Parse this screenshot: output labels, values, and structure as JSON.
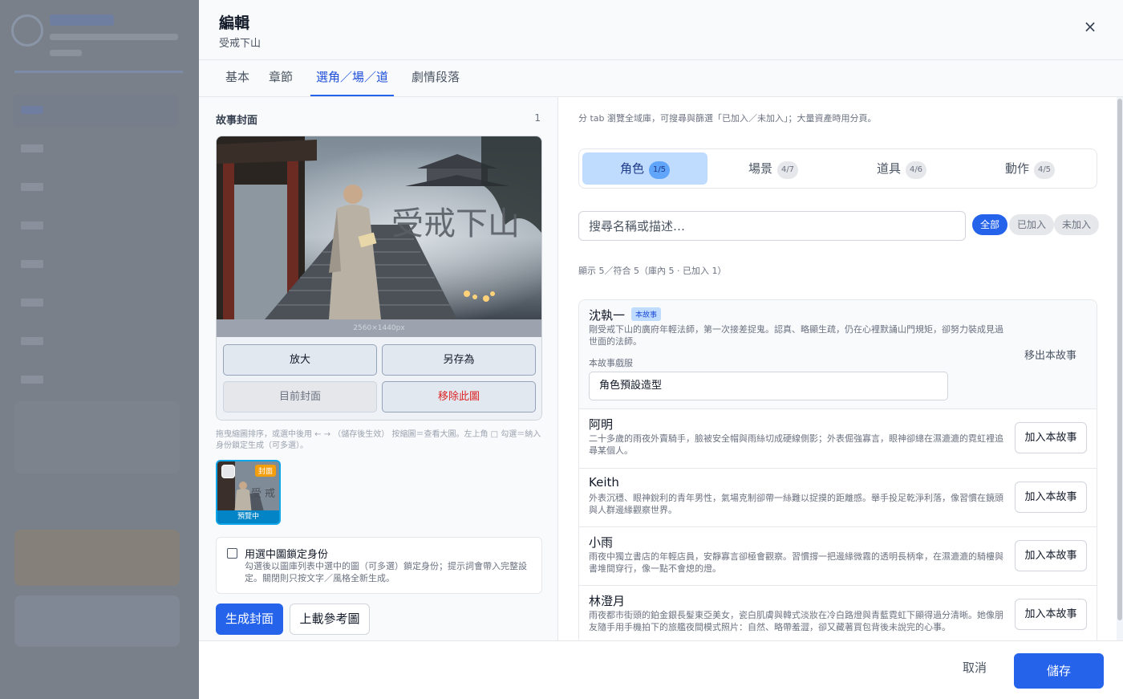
{
  "drawer": {
    "title": "編輯",
    "subtitle": "受戒下山",
    "close_glyph": "×"
  },
  "tabs": [
    {
      "label": "基本",
      "active": false
    },
    {
      "label": "章節",
      "active": false
    },
    {
      "label": "選角／場／道具",
      "active": true
    },
    {
      "label": "劇情段落",
      "active": false
    }
  ],
  "cover": {
    "section_title": "故事封面",
    "count": "1",
    "image_title": "受戒下山",
    "dimensions": "2560×1440px",
    "buttons": {
      "zoom": "放大",
      "save_as": "另存為",
      "current_cover": "目前封面",
      "remove": "移除此圖"
    },
    "hint": "拖曳縮圖排序，或選中後用 ← → （儲存後生效） 按縮圖＝查看大圖。左上角 □ 勾選＝納入身份鎖定生成（可多選）。",
    "thumbnail": {
      "badge": "封面",
      "status": "預覽中",
      "image_text": "受 戒"
    },
    "lock": {
      "label": "用選中圖鎖定身份",
      "description": "勾選後以圖庫列表中選中的圖（可多選）鎖定身份；提示詞會帶入完整設定。關閉則只按文字／風格全新生成。",
      "checked": false
    },
    "generate_label": "生成封面",
    "upload_label": "上載參考圖"
  },
  "assets": {
    "intro": "分 tab 瀏覽全域庫，可搜尋與篩選「已加入／未加入」；大量資產時用分頁。",
    "tabs": [
      {
        "label": "角色",
        "count": "1/5",
        "active": true
      },
      {
        "label": "場景",
        "count": "4/7",
        "active": false
      },
      {
        "label": "道具",
        "count": "4/6",
        "active": false
      },
      {
        "label": "動作",
        "count": "4/5",
        "active": false
      }
    ],
    "search_placeholder": "搜尋名稱或描述…",
    "filters": [
      {
        "label": "全部",
        "active": true
      },
      {
        "label": "已加入",
        "active": false
      },
      {
        "label": "未加入",
        "active": false
      }
    ],
    "summary": "顯示 5／符合 5（庫內 5 · 已加入 1）",
    "items": [
      {
        "name": "沈執一",
        "badge": "本故事",
        "description": "剛受戒下山的廣府年輕法師，第一次接差捉鬼。認真、略顯生疏，仍在心裡默誦山門規矩，卻努力裝成見過世面的法師。",
        "action": "移出本故事",
        "costume_label": "本故事戲服",
        "costume_value": "角色預設造型"
      },
      {
        "name": "阿明",
        "description": "二十多歲的雨夜外賣騎手，臉被安全帽與雨絲切成硬線側影；外表倔強寡言，眼神卻總在濕漉漉的霓虹裡追尋某個人。",
        "action": "加入本故事"
      },
      {
        "name": "Keith",
        "description": "外表沉穩、眼神銳利的青年男性，氣場克制卻帶一絲難以捉摸的距離感。舉手投足乾淨利落，像習慣在鏡頭與人群邊緣觀察世界。",
        "action": "加入本故事"
      },
      {
        "name": "小雨",
        "description": "雨夜中獨立書店的年輕店員，安靜寡言卻極會觀察。習慣撐一把邊緣微霧的透明長柄傘，在濕漉漉的騎樓與書堆間穿行，像一點不會熄的燈。",
        "action": "加入本故事"
      },
      {
        "name": "林澄月",
        "description": "雨夜都市街頭的鉑金銀長髮東亞美女，瓷白肌膚與韓式淡妝在冷白路燈與青藍霓虹下顯得過分清晰。她像朋友隨手用手機拍下的旅艦夜間模式照片：自然、略帶羞澀，卻又藏著買包背後未說完的心事。",
        "action": "加入本故事"
      }
    ]
  },
  "footer": {
    "cancel_label": "取消",
    "save_label": "儲存"
  },
  "colors": {
    "accent": "#2563eb",
    "accent_light": "#bfdbfe",
    "danger": "#dc2626",
    "thumb_border": "#0ea5e9",
    "badge_orange": "#f59e0b"
  },
  "icons": {
    "close": "close-icon",
    "checkbox": "checkbox-icon"
  }
}
